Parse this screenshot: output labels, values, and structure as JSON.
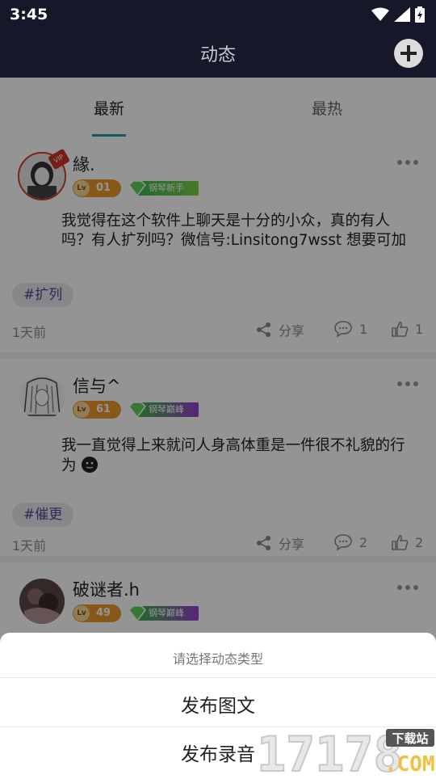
{
  "status_bar": {
    "time": "3:45"
  },
  "header": {
    "title": "动态",
    "add_icon": "plus-circle-icon"
  },
  "tabs": [
    {
      "label": "最新",
      "active": true
    },
    {
      "label": "最热",
      "active": false
    }
  ],
  "posts": [
    {
      "username": "緣.",
      "vip": true,
      "vip_badge": "VIP",
      "level_prefix": "Lv",
      "level": "01",
      "rank": "钢琴新手",
      "content": "我觉得在这个软件上聊天是十分的小众，真的有人吗？有人扩列吗？微信号:Linsitong7wsst   想要可加",
      "tag": "#扩列",
      "time": "1天前",
      "share_label": "分享",
      "comments": "1",
      "likes": "1"
    },
    {
      "username": "信与^",
      "vip": false,
      "level_prefix": "Lv",
      "level": "61",
      "rank": "钢琴巅峰",
      "content": "我一直觉得上来就问人身高体重是一件很不礼貌的行为",
      "tag": "#催更",
      "time": "1天前",
      "share_label": "分享",
      "comments": "2",
      "likes": "2"
    },
    {
      "username": "破谜者.h",
      "vip": false,
      "level_prefix": "Lv",
      "level": "49",
      "rank": "钢琴巅峰"
    }
  ],
  "sheet": {
    "title": "请选择动态类型",
    "options": [
      "发布图文",
      "发布录音"
    ]
  },
  "watermark": {
    "text": "17178",
    "badge": "下载站",
    "suffix": ".COM"
  },
  "colors": {
    "header_bg": "#17172a",
    "accent": "#21a39b",
    "level_orange": "#e8982c",
    "rank_green": "#3fb54a",
    "rank_purple": "#9a3fcf",
    "tag_text": "#4a4a9a"
  }
}
